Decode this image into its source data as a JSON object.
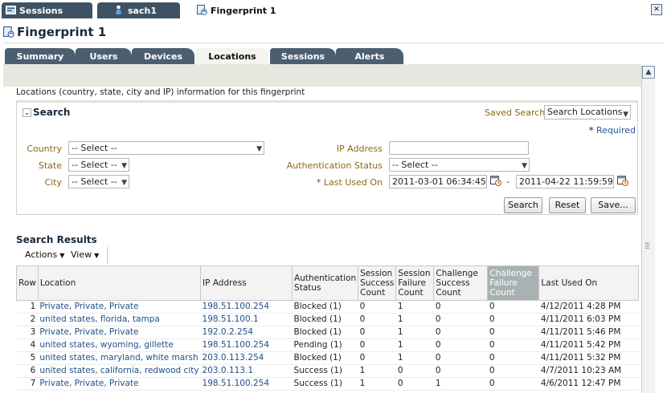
{
  "doc_tabs": [
    {
      "label": "Sessions"
    },
    {
      "label": "sach1"
    },
    {
      "label": "Fingerprint 1"
    }
  ],
  "page_title": "Fingerprint 1",
  "sub_tabs": [
    "Summary",
    "Users",
    "Devices",
    "Locations",
    "Sessions",
    "Alerts"
  ],
  "active_sub_tab": "Locations",
  "intro_text": "Locations (country, state, city and IP) information for this fingerprint",
  "search": {
    "title": "Search",
    "saved_search_label": "Saved Search",
    "saved_search_value": "Search Locations",
    "required_marker": "*",
    "required_text": " Required",
    "country_label": "Country",
    "country_value": "-- Select --",
    "state_label": "State",
    "state_value": "-- Select --",
    "city_label": "City",
    "city_value": "-- Select --",
    "ip_label": "IP Address",
    "ip_value": "",
    "auth_status_label": "Authentication Status",
    "auth_status_value": "-- Select --",
    "last_used_marker": "*",
    "last_used_label": " Last Used On",
    "last_used_from": "2011-03-01 06:34:45 PM",
    "last_used_to": "2011-04-22 11:59:59 PM",
    "range_separator": "-",
    "buttons": {
      "search": "Search",
      "reset": "Reset",
      "save": "Save..."
    }
  },
  "results": {
    "title": "Search Results",
    "actions_label": "Actions",
    "view_label": "View",
    "columns": {
      "row": "Row",
      "location": "Location",
      "ip": "IP Address",
      "auth": "Authentication Status",
      "sess_success": "Session Success Count",
      "sess_failure": "Session Failure Count",
      "chal_success": "Challenge Success Count",
      "chal_failure": "Challenge Failure Count",
      "last_used": "Last Used On"
    },
    "rows": [
      {
        "row": "1",
        "location": "Private, Private, Private",
        "ip": "198.51.100.254",
        "auth": "Blocked (1)",
        "ss": "0",
        "sf": "1",
        "cs": "0",
        "cf": "0",
        "last": "4/12/2011 4:28 PM"
      },
      {
        "row": "2",
        "location": "united states, florida, tampa",
        "ip": "198.51.100.1",
        "auth": "Blocked (1)",
        "ss": "0",
        "sf": "1",
        "cs": "0",
        "cf": "0",
        "last": "4/11/2011 6:03 PM"
      },
      {
        "row": "3",
        "location": "Private, Private, Private",
        "ip": "192.0.2.254",
        "auth": "Blocked (1)",
        "ss": "0",
        "sf": "1",
        "cs": "0",
        "cf": "0",
        "last": "4/11/2011 5:46 PM"
      },
      {
        "row": "4",
        "location": "united states, wyoming, gillette",
        "ip": "198.51.100.254",
        "auth": "Pending (1)",
        "ss": "0",
        "sf": "1",
        "cs": "0",
        "cf": "0",
        "last": "4/11/2011 5:42 PM"
      },
      {
        "row": "5",
        "location": "united states, maryland, white marsh",
        "ip": "203.0.113.254",
        "auth": "Blocked (1)",
        "ss": "0",
        "sf": "1",
        "cs": "0",
        "cf": "0",
        "last": "4/11/2011 5:32 PM"
      },
      {
        "row": "6",
        "location": "united states, california, redwood city",
        "ip": "203.0.113.1",
        "auth": "Success (1)",
        "ss": "1",
        "sf": "0",
        "cs": "0",
        "cf": "0",
        "last": "4/7/2011 10:23 AM"
      },
      {
        "row": "7",
        "location": "Private, Private, Private",
        "ip": "198.51.100.254",
        "auth": "Success (1)",
        "ss": "1",
        "sf": "0",
        "cs": "1",
        "cf": "0",
        "last": "4/6/2011 12:47 PM"
      }
    ]
  },
  "icons": {
    "doc_tab_sessions": "sessions-icon",
    "doc_tab_user": "user-icon",
    "doc_tab_fingerprint": "fingerprint-icon",
    "close": "close-icon",
    "calendar": "calendar-icon",
    "dropdown": "chevron-down-icon"
  },
  "colors": {
    "tab_dark": "#3e5263",
    "label_gold": "#8a6a17",
    "link_blue": "#1f4f8a",
    "highlight_header": "#a8b2b2"
  }
}
